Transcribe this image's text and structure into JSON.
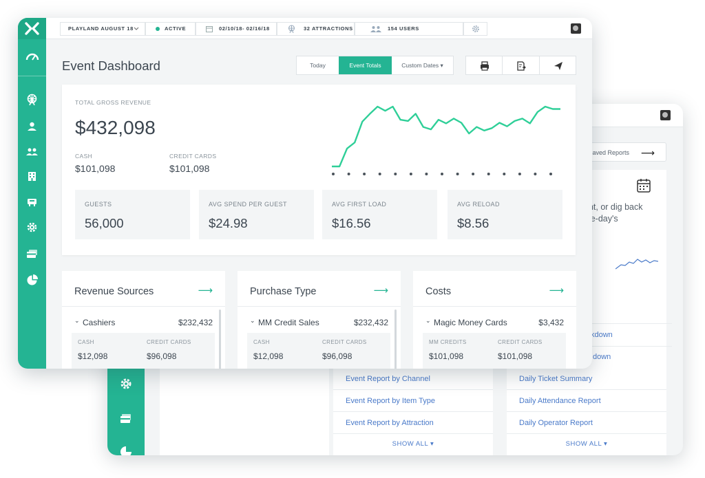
{
  "topbar": {
    "event_selector": "PLAYLAND AUGUST 18",
    "status": "ACTIVE",
    "status_color": "#24b493",
    "date_range": "02/10/18- 02/16/18",
    "attractions": "32 ATTRACTIONS",
    "users": "154 USERS"
  },
  "page_title": "Event Dashboard",
  "range_tabs": [
    {
      "label": "Today",
      "active": false
    },
    {
      "label": "Event Totals",
      "active": true
    },
    {
      "label": "Custom Dates ▾",
      "active": false
    }
  ],
  "summary": {
    "gross_label": "TOTAL GROSS REVENUE",
    "gross_value": "$432,098",
    "cash_label": "CASH",
    "cash_value": "$101,098",
    "credit_label": "CREDIT CARDS",
    "credit_value": "$101,098"
  },
  "chart_data": {
    "type": "line",
    "series": [
      {
        "values": [
          0,
          0,
          30,
          40,
          75,
          88,
          100,
          93,
          100,
          78,
          76,
          88,
          66,
          62,
          78,
          72,
          80,
          73,
          55,
          66,
          60,
          64,
          73,
          67,
          76,
          80,
          72,
          91,
          100,
          96,
          96
        ]
      }
    ],
    "color": "#2fcf98",
    "grid": false
  },
  "stats": [
    {
      "label": "GUESTS",
      "value": "56,000"
    },
    {
      "label": "AVG SPEND PER GUEST",
      "value": "$24.98"
    },
    {
      "label": "AVG FIRST LOAD",
      "value": "$16.56"
    },
    {
      "label": "AVG RELOAD",
      "value": "$8.56"
    }
  ],
  "panels": [
    {
      "title": "Revenue Sources",
      "row_name": "Cashiers",
      "row_value": "$232,432",
      "left_label": "CASH",
      "left_value": "$12,098",
      "right_label": "CREDIT CARDS",
      "right_value": "$96,098"
    },
    {
      "title": "Purchase Type",
      "row_name": "MM Credit Sales",
      "row_value": "$232,432",
      "left_label": "CASH",
      "left_value": "$12,098",
      "right_label": "CREDIT CARDS",
      "right_value": "$96,098"
    },
    {
      "title": "Costs",
      "row_name": "Magic Money Cards",
      "row_value": "$3,432",
      "left_label": "MM CREDITS",
      "left_value": "$101,098",
      "right_label": "CREDIT CARDS",
      "right_value": "$101,098"
    }
  ],
  "back": {
    "saved_reports": "e Saved Reports",
    "text1": "ent, or dig back",
    "text2": "gle-day's",
    "partial1": "kdown",
    "partial2": "down",
    "col1": [
      "Event Report by Channel",
      "Event Report by Item Type",
      "Event Report by Attraction"
    ],
    "col2": [
      "Daily Ticket Summary",
      "Daily Attendance Report",
      "Daily Operator Report"
    ],
    "show_all": "SHOW ALL ▾"
  },
  "icons": {
    "logo": "logo-icon",
    "dashboard": "speedometer-icon",
    "attractions": "ferris-wheel-icon",
    "users": "users-icon",
    "calendar": "calendar-icon",
    "settings": "gear-icon",
    "arrow": "arrow-right-icon"
  }
}
